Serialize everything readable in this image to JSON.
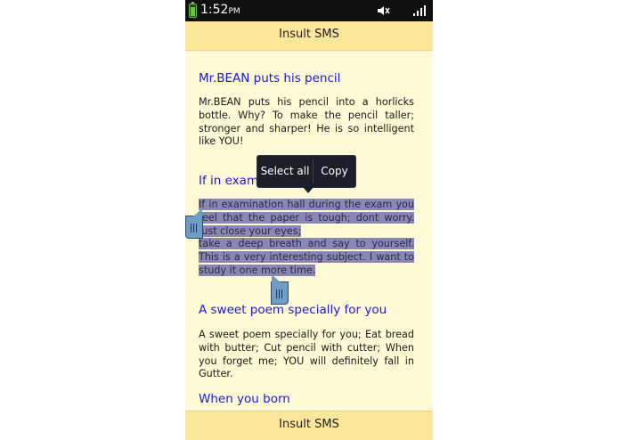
{
  "status_bar": {
    "time": "1:52",
    "ampm": "PM",
    "icons": [
      "battery-icon",
      "mute-icon",
      "signal-icon"
    ]
  },
  "header": {
    "title": "Insult SMS"
  },
  "footer": {
    "title": "Insult SMS"
  },
  "items": [
    {
      "title": "Mr.BEAN puts his pencil",
      "text": "Mr.BEAN puts his pencil into a horlicks bottle. Why? To make the pencil taller; stronger and sharper! He is so intelligent like YOU!"
    },
    {
      "title": "If in exami",
      "text_line1": "If in examination hall during the exam you feel that the paper is tough; dont worry. Just close your eyes;",
      "text_line2": "take a deep breath and say to yourself. This is a very interesting subject. I want to study it one more time."
    },
    {
      "title": "A sweet poem specially for you",
      "text": "A sweet poem specially for you; Eat bread with butter; Cut pencil with cutter; When you forget me; YOU will definitely fall in Gutter."
    },
    {
      "title": "When you born"
    }
  ],
  "selection_popup": {
    "select_all": "Select all",
    "copy": "Copy"
  },
  "colors": {
    "background": "#fff9d6",
    "bar": "#fbe69a",
    "heading": "#1b1bd6",
    "selection": "#8a86b6",
    "popup": "#1b1f2a",
    "handle": "#6f9dc4"
  }
}
